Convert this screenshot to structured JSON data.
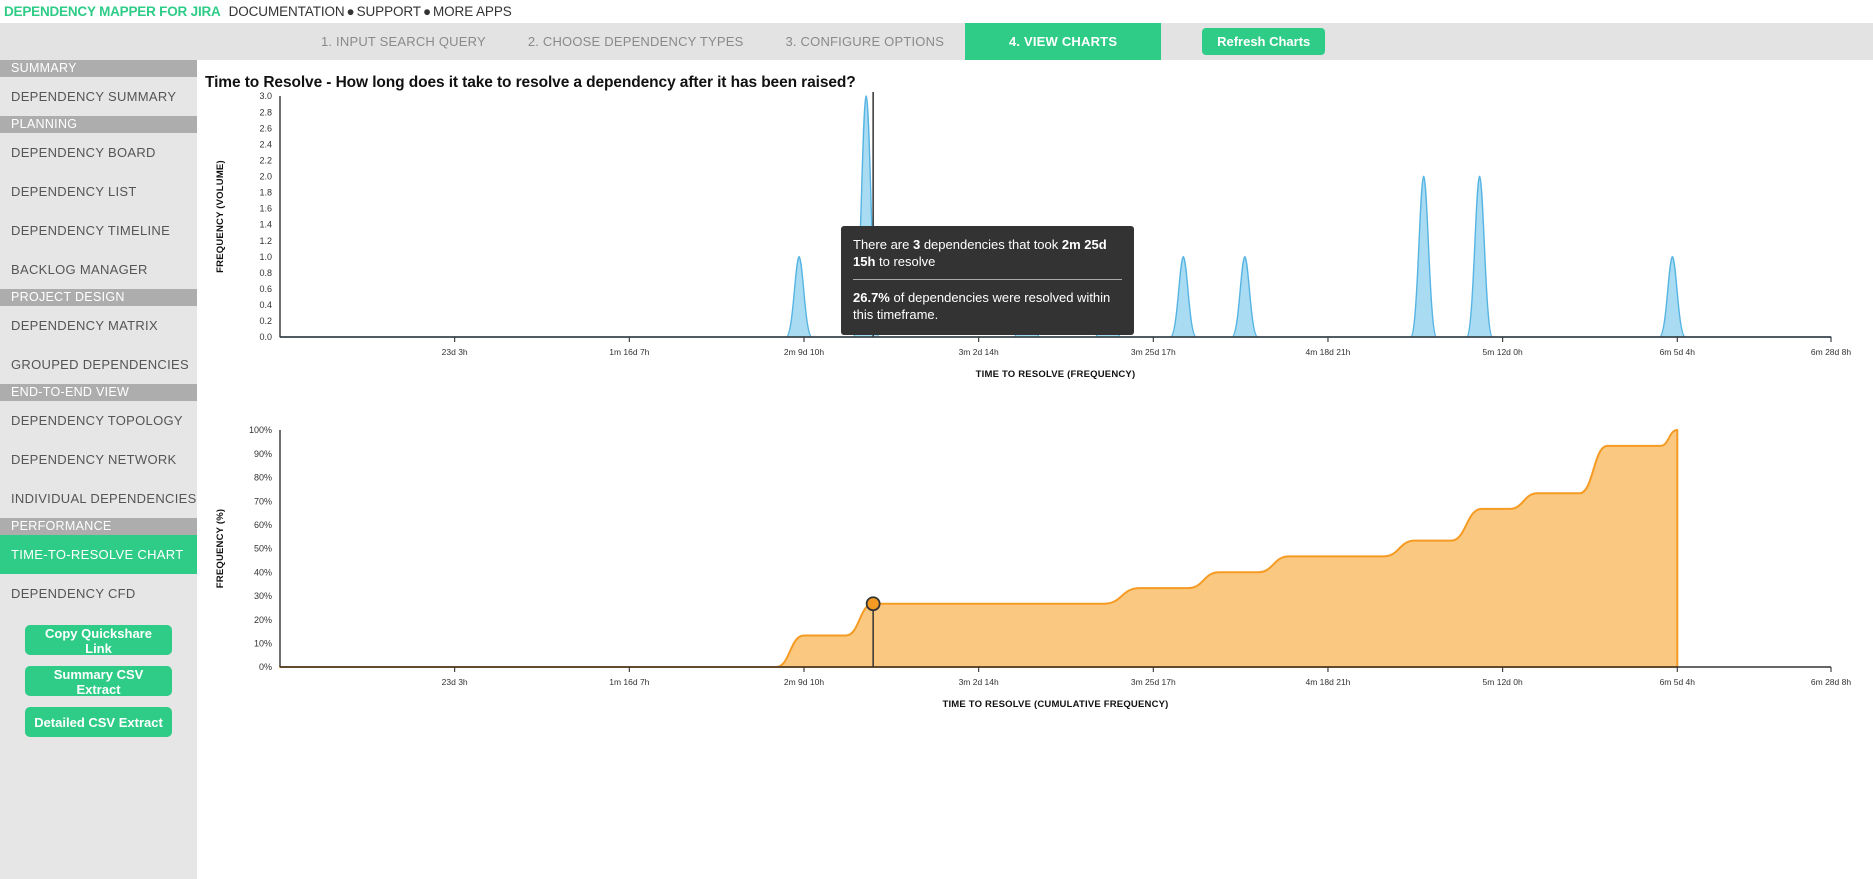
{
  "brand": {
    "name": "DEPENDENCY MAPPER FOR JIRA",
    "links": [
      "DOCUMENTATION",
      "SUPPORT",
      "MORE APPS"
    ],
    "separator": "●",
    "accent_color": "#2ecc87"
  },
  "nav": {
    "tabs": [
      {
        "label": "1. INPUT SEARCH QUERY",
        "active": false
      },
      {
        "label": "2. CHOOSE DEPENDENCY TYPES",
        "active": false
      },
      {
        "label": "3. CONFIGURE OPTIONS",
        "active": false
      },
      {
        "label": "4. VIEW CHARTS",
        "active": true
      }
    ],
    "refresh_label": "Refresh Charts"
  },
  "sidebar": {
    "entries": [
      {
        "type": "group",
        "label": "SUMMARY"
      },
      {
        "type": "item",
        "label": "DEPENDENCY SUMMARY",
        "active": false
      },
      {
        "type": "group",
        "label": "PLANNING"
      },
      {
        "type": "item",
        "label": "DEPENDENCY BOARD",
        "active": false
      },
      {
        "type": "item",
        "label": "DEPENDENCY LIST",
        "active": false
      },
      {
        "type": "item",
        "label": "DEPENDENCY TIMELINE",
        "active": false
      },
      {
        "type": "item",
        "label": "BACKLOG MANAGER",
        "active": false
      },
      {
        "type": "group",
        "label": "PROJECT DESIGN"
      },
      {
        "type": "item",
        "label": "DEPENDENCY MATRIX",
        "active": false
      },
      {
        "type": "item",
        "label": "GROUPED DEPENDENCIES",
        "active": false
      },
      {
        "type": "group",
        "label": "END-TO-END VIEW"
      },
      {
        "type": "item",
        "label": "DEPENDENCY TOPOLOGY",
        "active": false
      },
      {
        "type": "item",
        "label": "DEPENDENCY NETWORK",
        "active": false
      },
      {
        "type": "item",
        "label": "INDIVIDUAL DEPENDENCIES",
        "active": false
      },
      {
        "type": "group",
        "label": "PERFORMANCE"
      },
      {
        "type": "item",
        "label": "TIME-TO-RESOLVE CHART",
        "active": true
      },
      {
        "type": "item",
        "label": "DEPENDENCY CFD",
        "active": false
      }
    ],
    "buttons": [
      {
        "label": "Copy Quickshare Link"
      },
      {
        "label": "Summary CSV Extract"
      },
      {
        "label": "Detailed CSV Extract"
      }
    ]
  },
  "page": {
    "title": "Time to Resolve - How long does it take to resolve a dependency after it has been raised?"
  },
  "tooltip": {
    "line1_pre": "There are ",
    "line1_count": "3",
    "line1_mid": " dependencies that took ",
    "line1_value": "2m 25d 15h",
    "line1_post": " to resolve",
    "line2_pct": "26.7%",
    "line2_post": " of dependencies were resolved within this timeframe."
  },
  "chart_data": [
    {
      "type": "area",
      "id": "frequency-chart",
      "title": "",
      "xlabel": "TIME TO RESOLVE (FREQUENCY)",
      "ylabel": "FREQUENCY (VOLUME)",
      "ylim": [
        0,
        3.0
      ],
      "yticks": [
        "0.0",
        "0.2",
        "0.4",
        "0.6",
        "0.8",
        "1.0",
        "1.2",
        "1.4",
        "1.6",
        "1.8",
        "2.0",
        "2.2",
        "2.4",
        "2.6",
        "2.8",
        "3.0"
      ],
      "xticks": [
        "23d 3h",
        "1m 16d 7h",
        "2m 9d 10h",
        "3m 2d 14h",
        "3m 25d 17h",
        "4m 18d 21h",
        "5m 12d 0h",
        "6m 5d 4h",
        "6m 28d 8h"
      ],
      "xtick_positions": [
        0.125,
        0.25,
        0.375,
        0.5,
        0.625,
        0.75,
        0.875,
        1.0,
        1.11
      ],
      "grid": false,
      "series_color": "#56b4e3",
      "fill_color": "#a9dcf2",
      "peaks": [
        {
          "x": 0.3715,
          "y": 1.0
        },
        {
          "x": 0.4195,
          "y": 3.0
        },
        {
          "x": 0.5345,
          "y": 1.0
        },
        {
          "x": 0.5925,
          "y": 1.0
        },
        {
          "x": 0.6465,
          "y": 1.0
        },
        {
          "x": 0.6905,
          "y": 1.0
        },
        {
          "x": 0.8185,
          "y": 2.0
        },
        {
          "x": 0.8585,
          "y": 2.0
        },
        {
          "x": 0.9965,
          "y": 1.0
        }
      ],
      "marker_x": 0.4245,
      "marker_value": "2m 25d 15h"
    },
    {
      "type": "area",
      "id": "cumulative-chart",
      "title": "",
      "xlabel": "TIME TO RESOLVE (CUMULATIVE FREQUENCY)",
      "ylabel": "FREQUENCY (%)",
      "ylim": [
        0,
        100
      ],
      "yticks": [
        "0%",
        "10%",
        "20%",
        "30%",
        "40%",
        "50%",
        "60%",
        "70%",
        "80%",
        "90%",
        "100%"
      ],
      "xticks": [
        "23d 3h",
        "1m 16d 7h",
        "2m 9d 10h",
        "3m 2d 14h",
        "3m 25d 17h",
        "4m 18d 21h",
        "5m 12d 0h",
        "6m 5d 4h",
        "6m 28d 8h"
      ],
      "grid": false,
      "line_color": "#f59b23",
      "fill_color": "#fbc881",
      "marker_color": "#f59b23",
      "marker_x": 0.4245,
      "marker_y": 26.7,
      "steps": [
        {
          "x": 0.355,
          "y": 0
        },
        {
          "x": 0.375,
          "y": 13.3
        },
        {
          "x": 0.405,
          "y": 13.3
        },
        {
          "x": 0.4245,
          "y": 26.7
        },
        {
          "x": 0.59,
          "y": 26.7
        },
        {
          "x": 0.615,
          "y": 33.3
        },
        {
          "x": 0.65,
          "y": 33.3
        },
        {
          "x": 0.672,
          "y": 40.0
        },
        {
          "x": 0.7,
          "y": 40.0
        },
        {
          "x": 0.722,
          "y": 46.7
        },
        {
          "x": 0.79,
          "y": 46.7
        },
        {
          "x": 0.812,
          "y": 53.3
        },
        {
          "x": 0.838,
          "y": 53.3
        },
        {
          "x": 0.86,
          "y": 66.7
        },
        {
          "x": 0.88,
          "y": 66.7
        },
        {
          "x": 0.9,
          "y": 73.3
        },
        {
          "x": 0.93,
          "y": 73.3
        },
        {
          "x": 0.95,
          "y": 93.3
        },
        {
          "x": 0.988,
          "y": 93.3
        },
        {
          "x": 1.0,
          "y": 100
        }
      ]
    }
  ]
}
